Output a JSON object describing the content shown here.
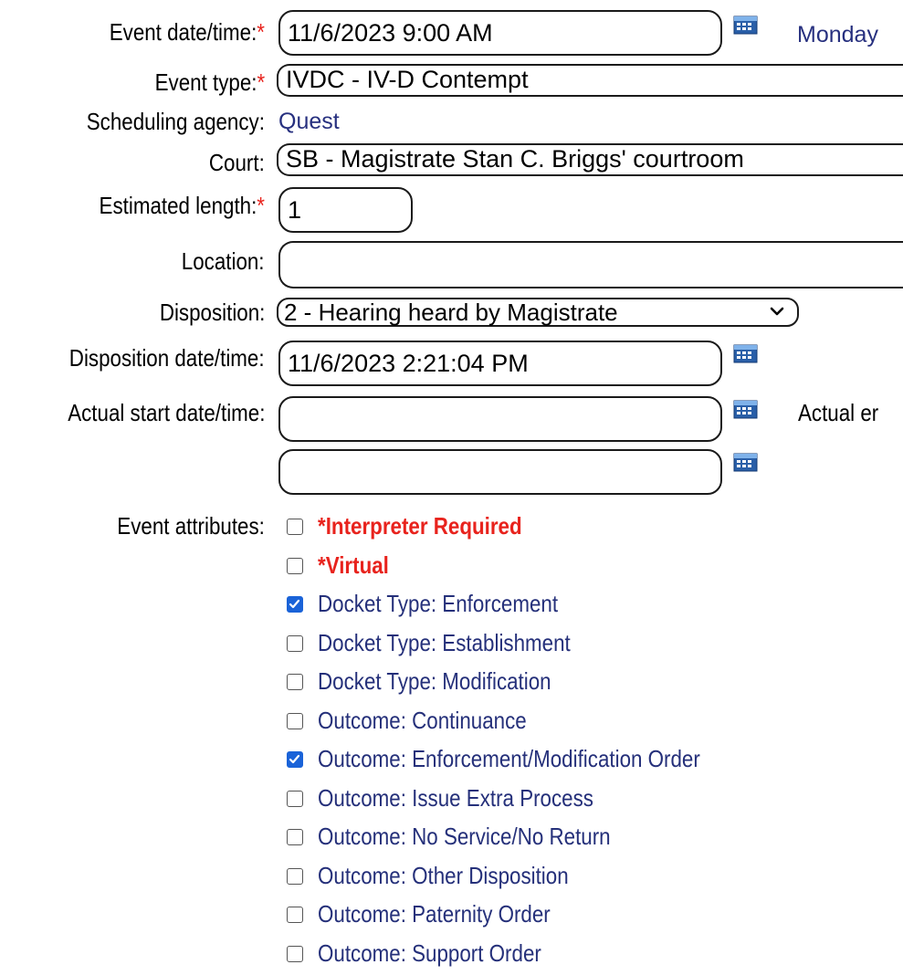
{
  "form": {
    "event_datetime": {
      "label": "Event date/time:",
      "required_mark": "*",
      "value": "11/6/2023 9:00 AM",
      "day": "Monday",
      "calendar_icon": "calendar-icon"
    },
    "event_type": {
      "label": "Event type:",
      "required_mark": "*",
      "value": "IVDC - IV-D Contempt"
    },
    "scheduling_agency": {
      "label": "Scheduling agency:",
      "value": "Quest"
    },
    "court": {
      "label": "Court:",
      "value": "SB - Magistrate Stan C. Briggs' courtroom"
    },
    "estimated_length": {
      "label": "Estimated length:",
      "required_mark": "*",
      "value": "1"
    },
    "location": {
      "label": "Location:",
      "value": ""
    },
    "disposition": {
      "label": "Disposition:",
      "value": "2 - Hearing heard by Magistrate",
      "icon": "chevron-down-icon"
    },
    "disposition_datetime": {
      "label": "Disposition date/time:",
      "value": "11/6/2023 2:21:04 PM",
      "calendar_icon": "calendar-icon"
    },
    "actual_start_datetime": {
      "label": "Actual start date/time:",
      "date_value": "",
      "time_value": "",
      "calendar_icon": "calendar-icon",
      "actual_end_label_partial": "Actual er"
    },
    "event_attributes": {
      "label": "Event attributes:",
      "items": [
        {
          "label": "*Interpreter Required",
          "checked": false,
          "required": true
        },
        {
          "label": "*Virtual",
          "checked": false,
          "required": true
        },
        {
          "label": "Docket Type: Enforcement",
          "checked": true,
          "required": false
        },
        {
          "label": "Docket Type: Establishment",
          "checked": false,
          "required": false
        },
        {
          "label": "Docket Type: Modification",
          "checked": false,
          "required": false
        },
        {
          "label": "Outcome: Continuance",
          "checked": false,
          "required": false
        },
        {
          "label": "Outcome: Enforcement/Modification Order",
          "checked": true,
          "required": false
        },
        {
          "label": "Outcome: Issue Extra Process",
          "checked": false,
          "required": false
        },
        {
          "label": "Outcome: No Service/No Return",
          "checked": false,
          "required": false
        },
        {
          "label": "Outcome: Other Disposition",
          "checked": false,
          "required": false
        },
        {
          "label": "Outcome: Paternity Order",
          "checked": false,
          "required": false
        },
        {
          "label": "Outcome: Support Order",
          "checked": false,
          "required": false
        }
      ]
    }
  },
  "colors": {
    "required": "#e8231d",
    "link_text": "#27307f",
    "checkbox_checked": "#1a63d8"
  }
}
